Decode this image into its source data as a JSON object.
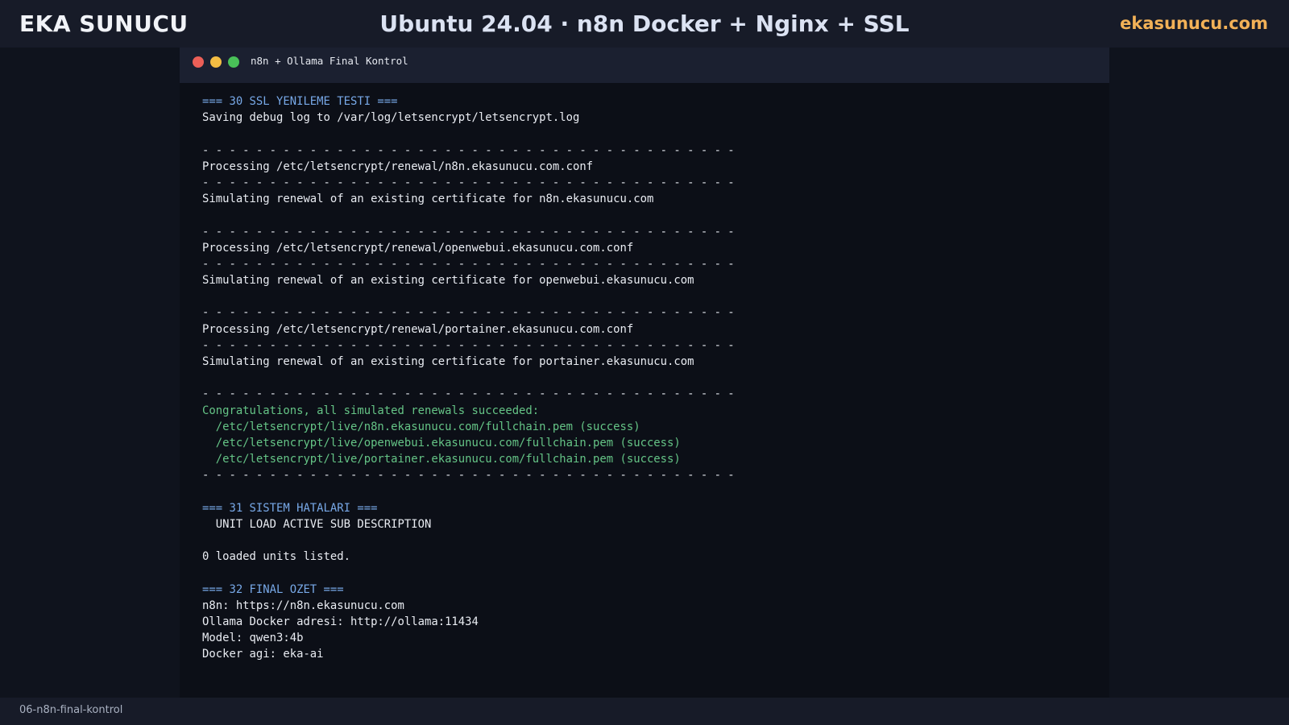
{
  "header": {
    "brand": "EKA SUNUCU",
    "title": "Ubuntu 24.04 · n8n Docker + Nginx + SSL",
    "site": "ekasunucu.com"
  },
  "terminal": {
    "window_title": "n8n + Ollama Final Kontrol",
    "lines": [
      {
        "text": "=== 30 SSL YENILEME TESTI ===",
        "style": "head"
      },
      {
        "text": "Saving debug log to /var/log/letsencrypt/letsencrypt.log",
        "style": "normal"
      },
      {
        "text": "",
        "style": "normal"
      },
      {
        "text": "- - - - - - - - - - - - - - - - - - - - - - - - - - - - - - - - - - - - - - - -",
        "style": "sep"
      },
      {
        "text": "Processing /etc/letsencrypt/renewal/n8n.ekasunucu.com.conf",
        "style": "normal"
      },
      {
        "text": "- - - - - - - - - - - - - - - - - - - - - - - - - - - - - - - - - - - - - - - -",
        "style": "sep"
      },
      {
        "text": "Simulating renewal of an existing certificate for n8n.ekasunucu.com",
        "style": "normal"
      },
      {
        "text": "",
        "style": "normal"
      },
      {
        "text": "- - - - - - - - - - - - - - - - - - - - - - - - - - - - - - - - - - - - - - - -",
        "style": "sep"
      },
      {
        "text": "Processing /etc/letsencrypt/renewal/openwebui.ekasunucu.com.conf",
        "style": "normal"
      },
      {
        "text": "- - - - - - - - - - - - - - - - - - - - - - - - - - - - - - - - - - - - - - - -",
        "style": "sep"
      },
      {
        "text": "Simulating renewal of an existing certificate for openwebui.ekasunucu.com",
        "style": "normal"
      },
      {
        "text": "",
        "style": "normal"
      },
      {
        "text": "- - - - - - - - - - - - - - - - - - - - - - - - - - - - - - - - - - - - - - - -",
        "style": "sep"
      },
      {
        "text": "Processing /etc/letsencrypt/renewal/portainer.ekasunucu.com.conf",
        "style": "normal"
      },
      {
        "text": "- - - - - - - - - - - - - - - - - - - - - - - - - - - - - - - - - - - - - - - -",
        "style": "sep"
      },
      {
        "text": "Simulating renewal of an existing certificate for portainer.ekasunucu.com",
        "style": "normal"
      },
      {
        "text": "",
        "style": "normal"
      },
      {
        "text": "- - - - - - - - - - - - - - - - - - - - - - - - - - - - - - - - - - - - - - - -",
        "style": "sep"
      },
      {
        "text": "Congratulations, all simulated renewals succeeded:",
        "style": "ok"
      },
      {
        "text": "  /etc/letsencrypt/live/n8n.ekasunucu.com/fullchain.pem (success)",
        "style": "ok"
      },
      {
        "text": "  /etc/letsencrypt/live/openwebui.ekasunucu.com/fullchain.pem (success)",
        "style": "ok"
      },
      {
        "text": "  /etc/letsencrypt/live/portainer.ekasunucu.com/fullchain.pem (success)",
        "style": "ok"
      },
      {
        "text": "- - - - - - - - - - - - - - - - - - - - - - - - - - - - - - - - - - - - - - - -",
        "style": "sep"
      },
      {
        "text": "",
        "style": "normal"
      },
      {
        "text": "=== 31 SISTEM HATALARI ===",
        "style": "head"
      },
      {
        "text": "  UNIT LOAD ACTIVE SUB DESCRIPTION",
        "style": "normal"
      },
      {
        "text": "",
        "style": "normal"
      },
      {
        "text": "0 loaded units listed.",
        "style": "normal"
      },
      {
        "text": "",
        "style": "normal"
      },
      {
        "text": "=== 32 FINAL OZET ===",
        "style": "head"
      },
      {
        "text": "n8n: https://n8n.ekasunucu.com",
        "style": "normal"
      },
      {
        "text": "Ollama Docker adresi: http://ollama:11434",
        "style": "normal"
      },
      {
        "text": "Model: qwen3:4b",
        "style": "normal"
      },
      {
        "text": "Docker agi: eka-ai",
        "style": "normal"
      }
    ]
  },
  "footer": {
    "label": "06-n8n-final-kontrol"
  },
  "colors": {
    "background": "#0f131d",
    "bar": "#171b28",
    "terminal_bg": "#0c0f17",
    "heading": "#78a9e8",
    "success": "#65c486",
    "accent": "#f2b157",
    "dot_red": "#ec5f57",
    "dot_yellow": "#f4bd43",
    "dot_green": "#49c158"
  }
}
